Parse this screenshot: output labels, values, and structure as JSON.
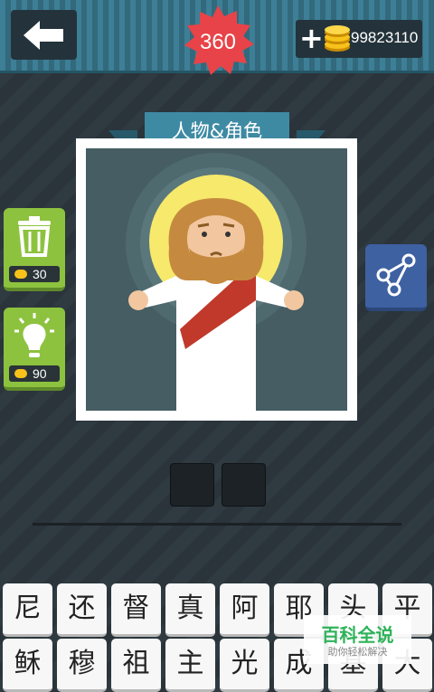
{
  "header": {
    "back_icon": "arrow-left-icon",
    "level": "360",
    "coin_icon": "coins-icon",
    "coins": "99823110"
  },
  "category": {
    "label": "人物&角色"
  },
  "puzzle": {
    "subject": "jesus-character-icon"
  },
  "side_buttons": {
    "remove": {
      "icon": "trash-icon",
      "cost": "30"
    },
    "hint": {
      "icon": "lightbulb-icon",
      "cost": "90"
    },
    "share": {
      "icon": "share-icon"
    }
  },
  "answer": {
    "slots": 2,
    "letters": [
      "",
      ""
    ]
  },
  "keyboard": {
    "row1": [
      "尼",
      "还",
      "督",
      "真",
      "阿",
      "耶",
      "头",
      "平"
    ],
    "row2": [
      "稣",
      "穆",
      "祖",
      "主",
      "光",
      "成",
      "基",
      "大"
    ]
  },
  "watermark": {
    "title": "百科全说",
    "subtitle": "助你轻松解决"
  },
  "colors": {
    "topbar": "#3d7f96",
    "badge": "#e84348",
    "green_btn": "#8dc23f",
    "share_btn": "#3e61a2",
    "halo": "#f6e96b",
    "robe_sash": "#c0392b"
  }
}
